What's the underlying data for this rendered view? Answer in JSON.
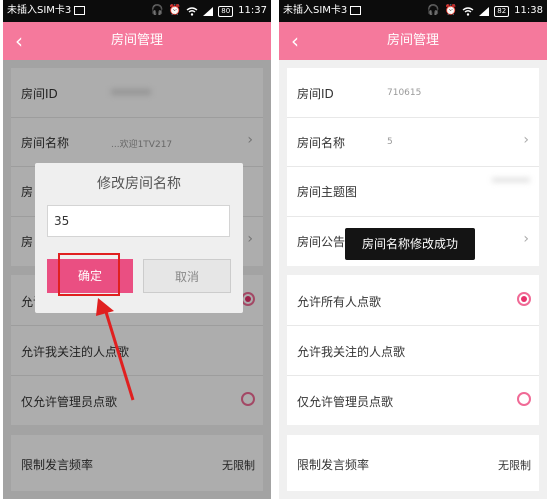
{
  "status_left": {
    "carrier": "未插入SIM卡3",
    "time": "11:37",
    "battery": "80"
  },
  "status_right": {
    "carrier": "未插入SIM卡3",
    "time": "11:38",
    "battery": "82"
  },
  "navbar": {
    "back_glyph": "‹",
    "title": "房间管理"
  },
  "left_info": {
    "room_id_label": "房间ID",
    "room_name_label": "房间名称",
    "room_name_value": "...欢迎1TV217",
    "theme_label": "房",
    "notice_label": "房",
    "chevron": "›"
  },
  "dialog": {
    "title": "修改房间名称",
    "input_value": "35",
    "confirm_label": "确定",
    "cancel_label": "取消"
  },
  "right_info": {
    "room_id_label": "房间ID",
    "room_id_value": "710615",
    "room_name_label": "房间名称",
    "room_name_value": "5",
    "theme_label": "房间主题图",
    "notice_label": "房间公告",
    "chevron": "›"
  },
  "toast": {
    "message": "房间名称修改成功"
  },
  "song_settings": {
    "allow_all_label": "允许所有人点歌",
    "allow_followed_label": "允许我关注的人点歌",
    "admins_only_label": "仅允许管理员点歌",
    "allow_all_selected": true
  },
  "rate_limit": {
    "label": "限制发言频率",
    "value": "无限制"
  },
  "colors": {
    "accent": "#f5799c",
    "confirm": "#ea4f82",
    "radio": "#e8326c",
    "highlight": "#e02020"
  },
  "icons": [
    "headphones-icon",
    "alarm-icon",
    "wifi-icon",
    "signal-icon",
    "battery-icon",
    "back-arrow-icon",
    "chevron-right-icon",
    "radio-icon",
    "red-arrow-icon"
  ]
}
